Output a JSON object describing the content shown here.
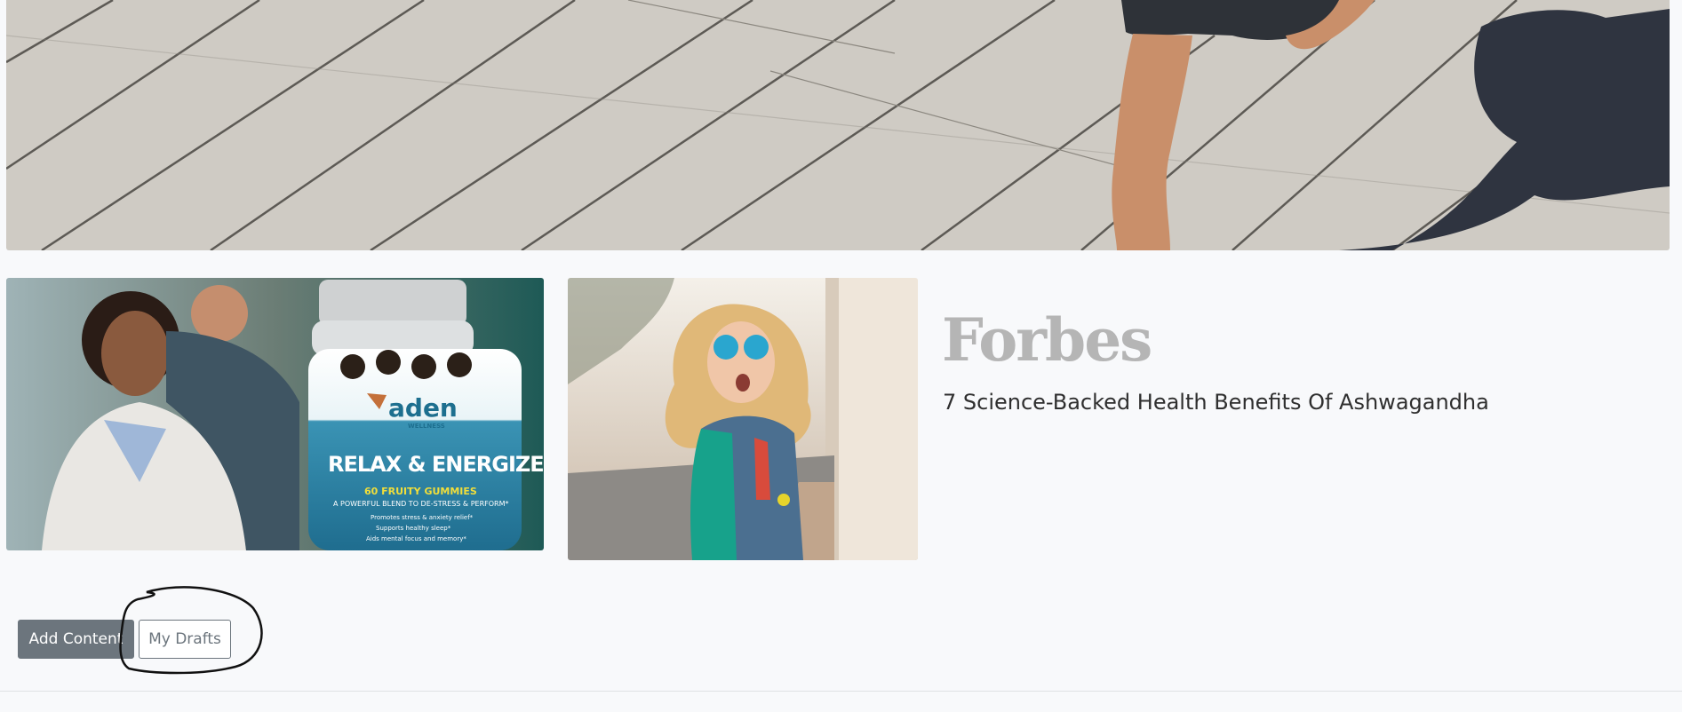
{
  "hero": {
    "alt": "runner-on-pavement-photo"
  },
  "gummies": {
    "brand": "aden",
    "brand_sub": "WELLNESS",
    "product": "RELAX & ENERGIZE",
    "count": "60 FRUITY GUMMIES",
    "tagline": "A POWERFUL BLEND TO DE-STRESS & PERFORM*",
    "bullets": [
      "Promotes stress & anxiety relief*",
      "Supports healthy sleep*",
      "Aids mental focus and memory*"
    ]
  },
  "article": {
    "publisher": "Forbes",
    "headline": "7 Science-Backed Health Benefits Of Ashwagandha"
  },
  "actions": {
    "add_content": "Add Content",
    "my_drafts": "My Drafts"
  }
}
